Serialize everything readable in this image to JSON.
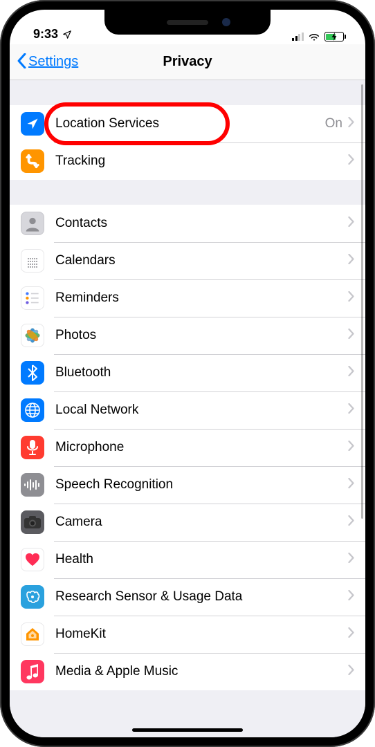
{
  "status": {
    "time": "9:33",
    "location_active": true
  },
  "nav": {
    "back_label": "Settings",
    "title": "Privacy"
  },
  "groups": [
    {
      "rows": [
        {
          "key": "location-services",
          "label": "Location Services",
          "value": "On",
          "icon": "location-icon",
          "bg": "ic-blue"
        },
        {
          "key": "tracking",
          "label": "Tracking",
          "value": "",
          "icon": "tracking-icon",
          "bg": "ic-orange"
        }
      ]
    },
    {
      "rows": [
        {
          "key": "contacts",
          "label": "Contacts",
          "value": "",
          "icon": "contacts-icon",
          "bg": "ic-gray"
        },
        {
          "key": "calendars",
          "label": "Calendars",
          "value": "",
          "icon": "calendar-icon",
          "bg": "calendar-icon"
        },
        {
          "key": "reminders",
          "label": "Reminders",
          "value": "",
          "icon": "reminders-icon",
          "bg": "ic-white"
        },
        {
          "key": "photos",
          "label": "Photos",
          "value": "",
          "icon": "photos-icon",
          "bg": "ic-white"
        },
        {
          "key": "bluetooth",
          "label": "Bluetooth",
          "value": "",
          "icon": "bluetooth-icon",
          "bg": "ic-blue"
        },
        {
          "key": "local-network",
          "label": "Local Network",
          "value": "",
          "icon": "network-icon",
          "bg": "ic-blue"
        },
        {
          "key": "microphone",
          "label": "Microphone",
          "value": "",
          "icon": "microphone-icon",
          "bg": "ic-red"
        },
        {
          "key": "speech-recognition",
          "label": "Speech Recognition",
          "value": "",
          "icon": "speech-icon",
          "bg": "ic-gray2"
        },
        {
          "key": "camera",
          "label": "Camera",
          "value": "",
          "icon": "camera-icon",
          "bg": "ic-darkgray"
        },
        {
          "key": "health",
          "label": "Health",
          "value": "",
          "icon": "health-icon",
          "bg": "ic-white"
        },
        {
          "key": "research",
          "label": "Research Sensor & Usage Data",
          "value": "",
          "icon": "research-icon",
          "bg": "ic-cyan"
        },
        {
          "key": "homekit",
          "label": "HomeKit",
          "value": "",
          "icon": "homekit-icon",
          "bg": "ic-white"
        },
        {
          "key": "media",
          "label": "Media & Apple Music",
          "value": "",
          "icon": "music-icon",
          "bg": "ic-pink"
        }
      ]
    }
  ],
  "highlighted_row": "location-services"
}
